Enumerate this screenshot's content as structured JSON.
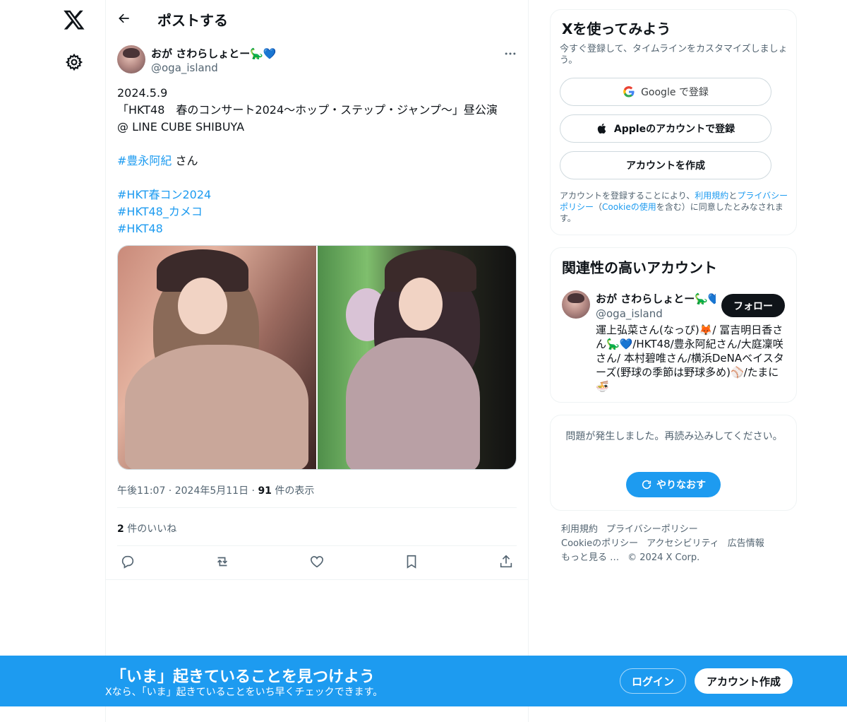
{
  "header": {
    "title": "ポストする"
  },
  "tweet": {
    "author_name": "おが さわらしょとー🦕💙",
    "author_handle": "@oga_island",
    "text_lines": [
      "2024.5.9",
      "「HKT48　春のコンサート2024〜ホップ・ステップ・ジャンプ〜」昼公演",
      "@ LINE CUBE SHIBUYA"
    ],
    "mention_hashtag": "#豊永阿紀",
    "mention_suffix": " さん",
    "hashtags": [
      "#HKT春コン2024",
      "#HKT48_カメコ",
      "#HKT48"
    ],
    "time": "午後11:07",
    "date": "2024年5月11日",
    "views_count": "91",
    "views_label": "件の表示",
    "likes_count": "2",
    "likes_label": "件のいいね"
  },
  "signup_card": {
    "title": "Xを使ってみよう",
    "subtitle": "今すぐ登録して、タイムラインをカスタマイズしましょう。",
    "google_label": "Google で登録",
    "apple_label": "Appleのアカウントで登録",
    "create_label": "アカウントを作成",
    "terms_1": "アカウントを登録することにより、",
    "terms_link_1": "利用規約",
    "terms_2": "と",
    "terms_link_2": "プライバシーポリシー",
    "terms_3": "（",
    "terms_link_3": "Cookieの使用",
    "terms_4": "を含む）に同意したとみなされます。"
  },
  "related": {
    "title": "関連性の高いアカウント",
    "name": "おが さわらしょとー🦕💙",
    "handle": "@oga_island",
    "follow_label": "フォロー",
    "bio": "運上弘菜さん(なっぴ)🦊/ 冨吉明日香さん🦕💙/HKT48/豊永阿紀さん/大庭凜咲さん/ 本村碧唯さん/横浜DeNAベイスターズ(野球の季節は野球多め)⚾/たまに🍜"
  },
  "error_card": {
    "message": "問題が発生しました。再読み込みしてください。",
    "retry_label": "やりなおす"
  },
  "footer": {
    "links": [
      "利用規約",
      "プライバシーポリシー",
      "Cookieのポリシー",
      "アクセシビリティ",
      "広告情報",
      "もっと見る …"
    ],
    "copyright": "© 2024 X Corp."
  },
  "bottom_bar": {
    "title": "「いま」起きていることを見つけよう",
    "subtitle": "Xなら、「いま」起きていることをいち早くチェックできます。",
    "login_label": "ログイン",
    "signup_label": "アカウント作成"
  },
  "colors": {
    "accent": "#1d9bf0",
    "text": "#0f1419",
    "muted": "#536471"
  },
  "icons": [
    "x-logo-icon",
    "gear-icon",
    "back-arrow-icon",
    "more-icon",
    "reply-icon",
    "repost-icon",
    "like-icon",
    "bookmark-icon",
    "share-icon",
    "google-icon",
    "apple-icon",
    "refresh-icon"
  ]
}
